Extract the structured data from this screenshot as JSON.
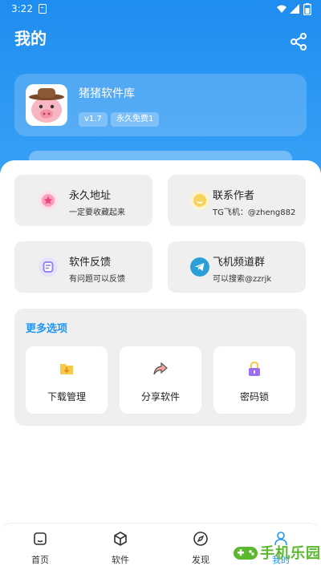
{
  "status_bar": {
    "time": "3:22"
  },
  "header": {
    "title": "我的",
    "share_icon": "share-icon"
  },
  "app_card": {
    "name": "猪猪软件库",
    "version": "v1.7",
    "badge": "永久免费1",
    "logo_icon": "pig-cowboy-logo"
  },
  "quick_links": [
    {
      "title": "永久地址",
      "subtitle": "一定要收藏起来",
      "icon": "star-icon",
      "color": "#f25c8a"
    },
    {
      "title": "联系作者",
      "subtitle": "TG飞机：@zheng882",
      "icon": "smile-icon",
      "color": "#f7c948"
    },
    {
      "title": "软件反馈",
      "subtitle": "有问题可以反馈",
      "icon": "feedback-icon",
      "color": "#8a7cf0"
    },
    {
      "title": "飞机频道群",
      "subtitle": "可以搜索@zzrjk",
      "icon": "telegram-icon",
      "color": "#2a9fd8"
    }
  ],
  "more_options": {
    "title": "更多选项",
    "items": [
      {
        "label": "下载管理",
        "icon": "download-folder-icon"
      },
      {
        "label": "分享软件",
        "icon": "share-arrow-icon"
      },
      {
        "label": "密码锁",
        "icon": "lock-icon"
      }
    ]
  },
  "bottom_nav": {
    "items": [
      {
        "label": "首页",
        "icon": "home-icon"
      },
      {
        "label": "软件",
        "icon": "box-icon"
      },
      {
        "label": "发现",
        "icon": "compass-icon"
      },
      {
        "label": "我的",
        "icon": "user-icon"
      }
    ],
    "active_index": 3
  },
  "watermark": {
    "text": "手机乐园"
  },
  "colors": {
    "primary": "#2196f3",
    "header_top": "#1f8df0",
    "header_bottom": "#3aa2f5",
    "tile_bg": "#efefef"
  }
}
